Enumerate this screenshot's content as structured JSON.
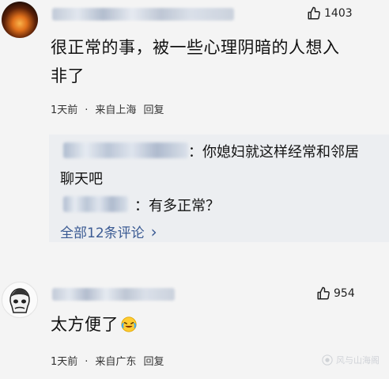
{
  "comments": [
    {
      "likes": "1403",
      "text": "很正常的事，被一些心理阴暗的人想入非了",
      "text_line1": "很正常的事，被一些心理阴暗的人想入",
      "text_line2": "非了",
      "time": "1天前",
      "location": "来自上海",
      "reply_label": "回复",
      "replies": [
        {
          "text": "你媳妇就这样经常和邻居聊天吧",
          "line1": "：你媳妇就这样经常和邻居",
          "line2": "聊天吧"
        },
        {
          "text": "：有多正常？"
        }
      ],
      "more_replies": "全部12条评论",
      "more_chevron": "›"
    },
    {
      "likes": "954",
      "text": "太方便了",
      "emoji": "crying-laughing-emoji",
      "time": "1天前",
      "location": "来自广东",
      "reply_label": "回复"
    }
  ],
  "watermark": "风与山海阁",
  "icons": {
    "like": "thumbs-up-icon",
    "chevron": "chevron-right-icon"
  },
  "colors": {
    "background": "#f4f4f4",
    "reply_box": "#eceef1",
    "link": "#3a5a93"
  }
}
